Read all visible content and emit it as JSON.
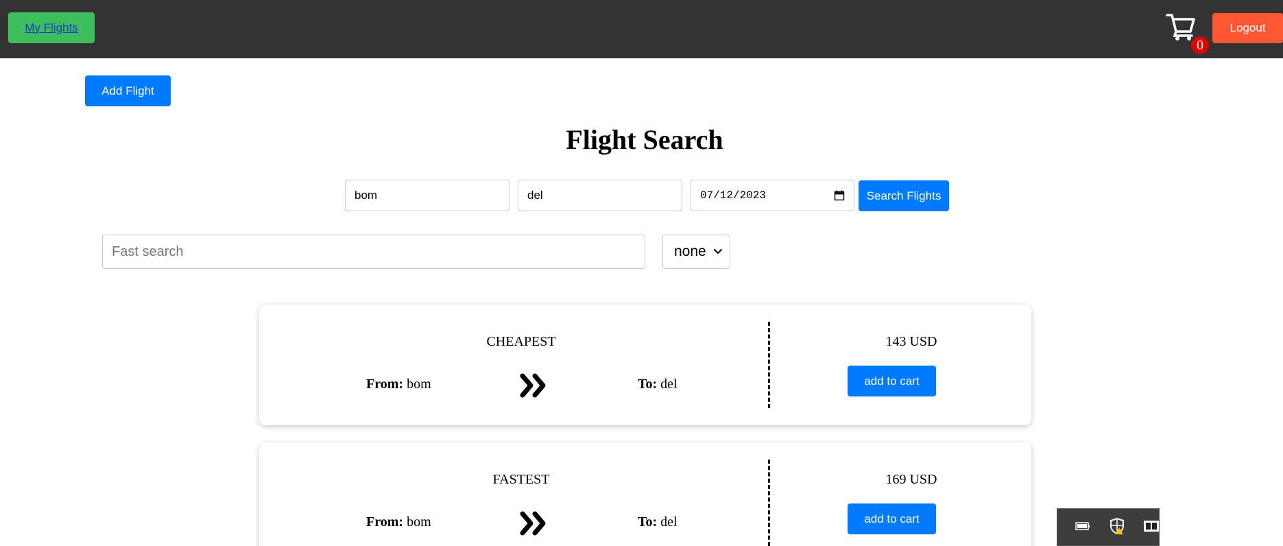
{
  "header": {
    "my_flights_label": "My Flights",
    "cart_count": "0",
    "logout_label": "Logout"
  },
  "toolbar": {
    "add_flight_label": "Add Flight"
  },
  "page_title": "Flight Search",
  "search": {
    "from_value": "bom",
    "to_value": "del",
    "date_value": "07/12/2023",
    "search_button_label": "Search Flights",
    "fast_search_placeholder": "Fast search",
    "sort_selected": "none"
  },
  "results": [
    {
      "label": "CHEAPEST",
      "from_label": "From:",
      "from_value": "bom",
      "to_label": "To:",
      "to_value": "del",
      "price": "143 USD",
      "cart_button_label": "add to cart"
    },
    {
      "label": "FASTEST",
      "from_label": "From:",
      "from_value": "bom",
      "to_label": "To:",
      "to_value": "del",
      "price": "169 USD",
      "cart_button_label": "add to cart"
    }
  ],
  "colors": {
    "topbar": "#333333",
    "my_flights_button": "#3cbf5c",
    "logout_button": "#ff5733",
    "primary_button": "#007bff",
    "cart_badge": "#e00000"
  },
  "icons": {
    "cart": "shopping-cart-icon",
    "arrow": "double-chevron-right-icon",
    "calendar": "calendar-icon",
    "select_caret": "chevron-down-icon",
    "tray": [
      "battery-icon",
      "security-shield-icon",
      "media-icon"
    ]
  }
}
